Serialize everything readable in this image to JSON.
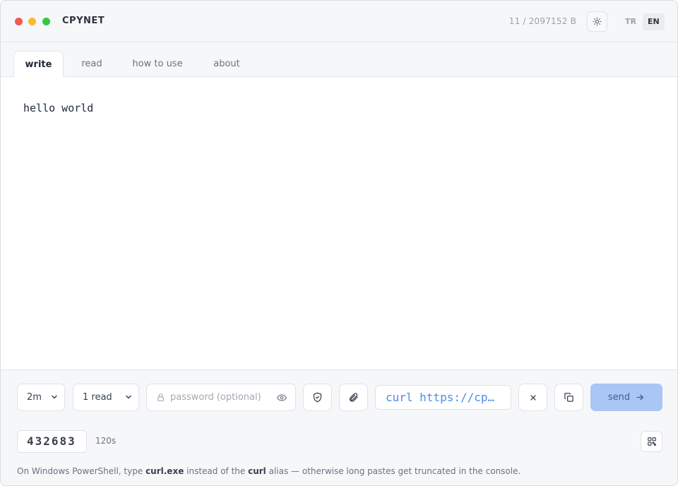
{
  "app": {
    "title": "CPYNET",
    "byte_counter": "11 / 2097152 B",
    "languages": [
      "TR",
      "EN"
    ],
    "active_language": "EN"
  },
  "tabs": [
    {
      "label": "write",
      "active": true
    },
    {
      "label": "read",
      "active": false
    },
    {
      "label": "how to use",
      "active": false
    },
    {
      "label": "about",
      "active": false
    }
  ],
  "editor": {
    "content": "hello world"
  },
  "controls": {
    "expire_value": "2m",
    "reads_value": "1 read",
    "password_placeholder": "password (optional)",
    "curl_command": "curl https://cpynet…",
    "send_label": "send",
    "accent_color": "#a9c6f5"
  },
  "footer": {
    "code": "432683",
    "timer": "120s",
    "hint_prefix": "On Windows PowerShell, type ",
    "hint_cmd1": "curl.exe",
    "hint_mid": " instead of the ",
    "hint_cmd2": "curl",
    "hint_suffix": " alias — otherwise long pastes get truncated in the console."
  },
  "icons": {
    "theme": "sun-icon",
    "lock": "lock-icon",
    "eye": "eye-icon",
    "shield": "shield-check-icon",
    "attach": "paperclip-icon",
    "clear": "close-icon",
    "copy": "copy-icon",
    "send": "arrow-right-icon",
    "qr": "qr-code-icon"
  }
}
